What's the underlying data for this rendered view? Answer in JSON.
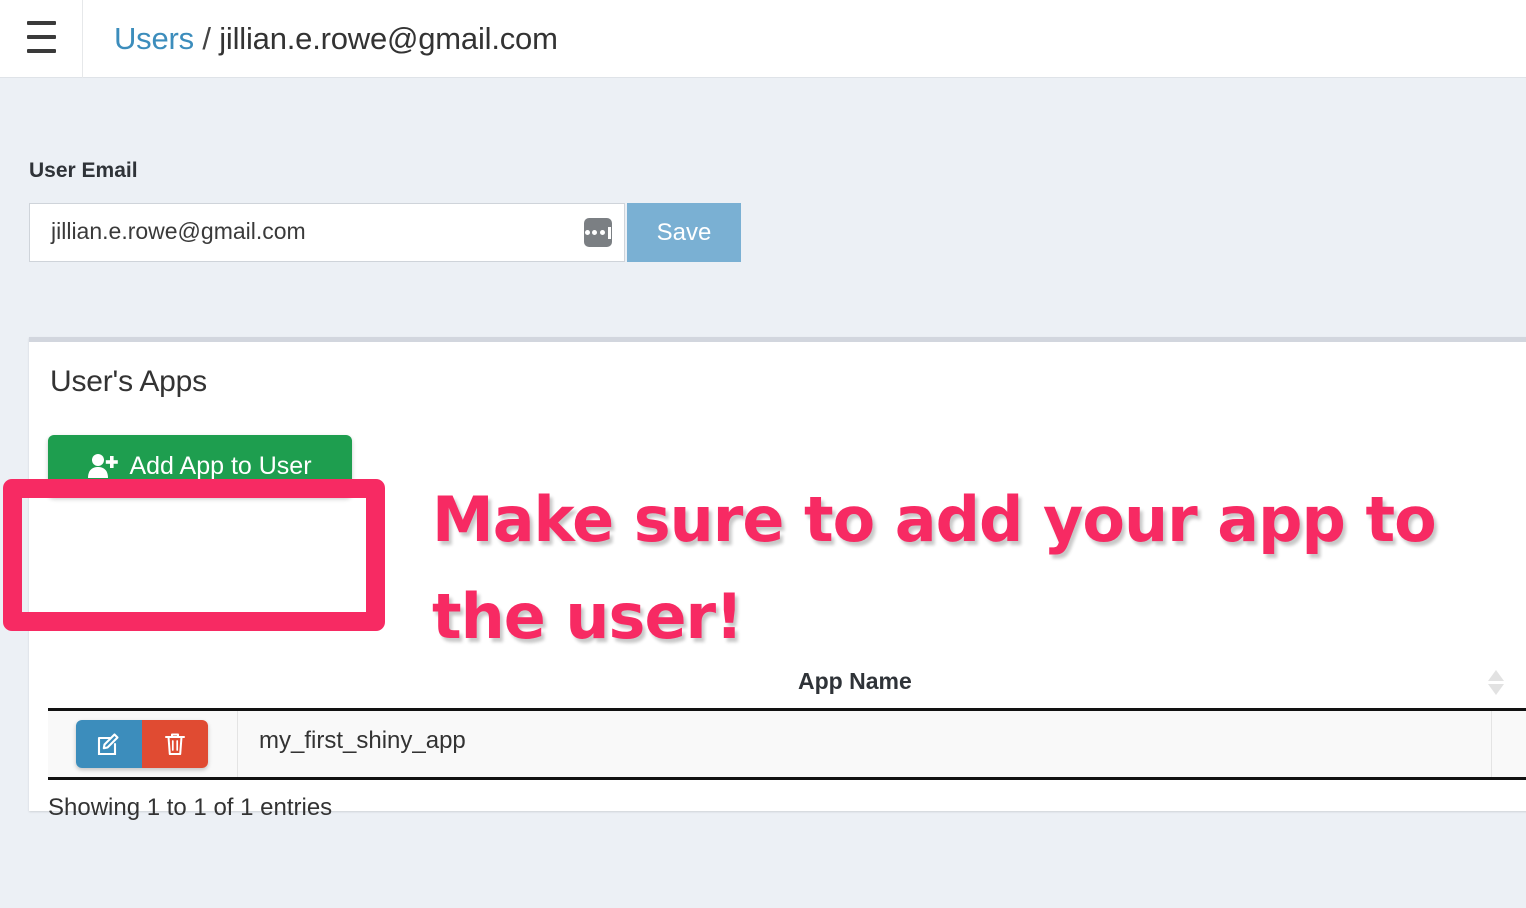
{
  "header": {
    "menu_icon": "hamburger-icon",
    "breadcrumb_link": "Users",
    "breadcrumb_separator": "/",
    "breadcrumb_current": "jillian.e.rowe@gmail.com"
  },
  "form": {
    "label": "User Email",
    "email_value": "jillian.e.rowe@gmail.com",
    "email_placeholder": "User Email",
    "autofill_icon": "password-manager-icon",
    "save_label": "Save",
    "save_color": "#7ab0d3"
  },
  "panel": {
    "title": "User's Apps",
    "add_button_label": "Add App to User",
    "add_button_icon": "user-plus-icon",
    "add_button_color": "#1e9e4f"
  },
  "table": {
    "columns": [
      "",
      "App Name",
      ""
    ],
    "header_label": "App Name",
    "sort_icon": "sort-both-icon",
    "rows": [
      {
        "edit_icon": "edit-pencil-icon",
        "delete_icon": "trash-icon",
        "app_name": "my_first_shiny_app"
      }
    ],
    "info": "Showing 1 to 1 of 1 entries",
    "edit_color": "#3c8dbc",
    "delete_color": "#e04b32"
  },
  "annotation": {
    "text": "Make sure to add your app to\nthe user!",
    "color": "#f72a63",
    "outline_color": "#ffffff",
    "box_shape": "rounded-rectangle"
  }
}
